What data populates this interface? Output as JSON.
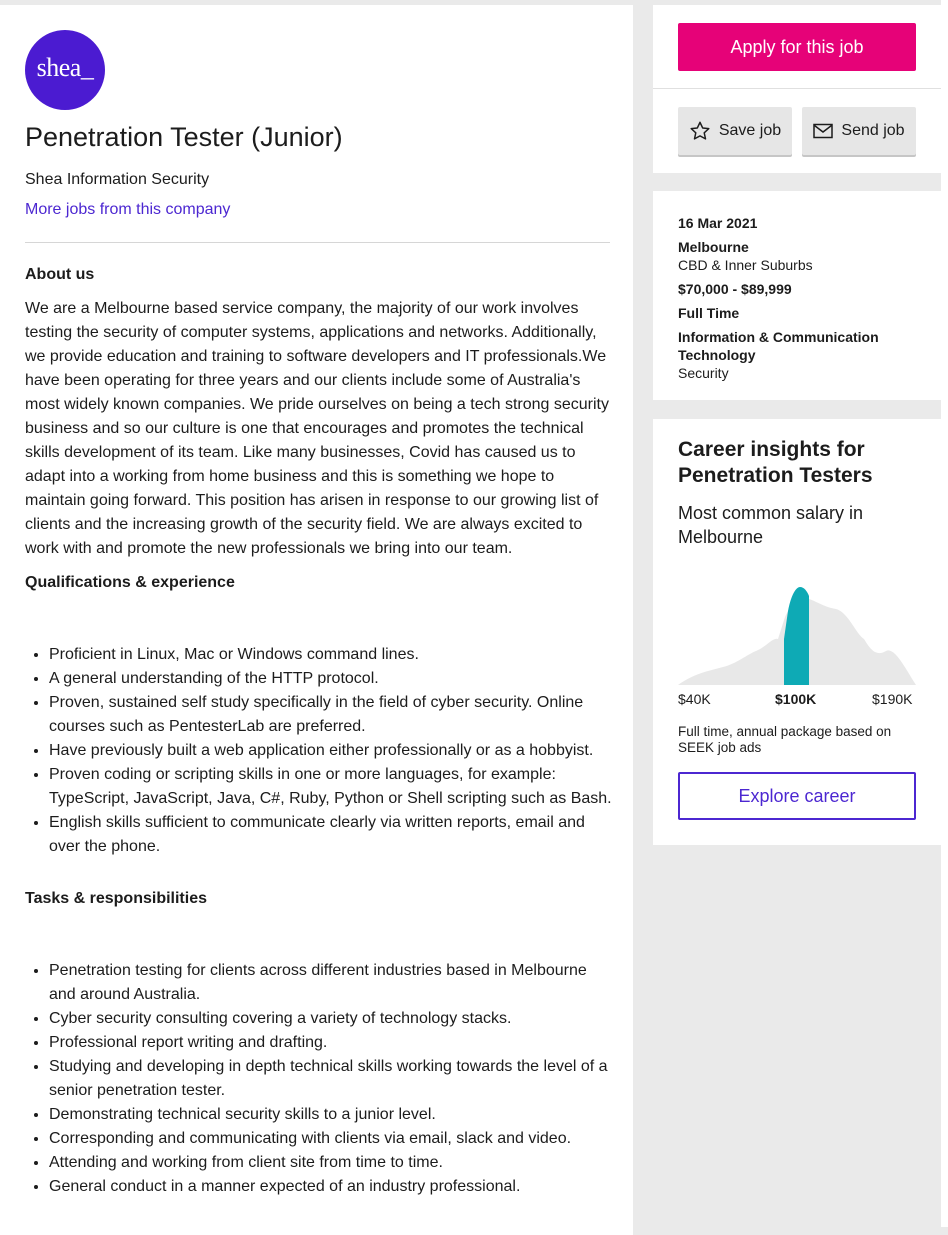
{
  "job": {
    "logo_text": "shea_",
    "title": "Penetration Tester (Junior)",
    "company": "Shea Information Security",
    "more_jobs": "More jobs from this company"
  },
  "about": {
    "heading": "About us",
    "text": "We are a Melbourne based service company, the majority of our work involves testing the security of computer systems, applications and networks. Additionally, we provide education and training to software developers and IT professionals.We have been operating for three years and our clients include some of Australia's most widely known companies. We pride ourselves on being a tech strong security business and so our culture is one that encourages and promotes the technical skills development of its team. Like many businesses, Covid has caused us to adapt into a working from home business and this is something we hope to maintain going forward. This position has arisen in response to our growing list of clients and the increasing growth of the security field. We are always excited to work with and promote the new professionals we bring into our team."
  },
  "qualifications": {
    "heading": "Qualifications & experience",
    "items": [
      "Proficient in Linux, Mac or Windows command lines.",
      "A general understanding of the HTTP protocol.",
      "Proven, sustained self study specifically in the field of cyber security. Online courses such as PentesterLab are preferred.",
      "Have previously built a web application either professionally or as a hobbyist.",
      "Proven coding or scripting skills in one or more languages, for example: TypeScript, JavaScript, Java, C#, Ruby, Python or Shell scripting such as Bash.",
      "English skills sufficient to communicate clearly via written reports, email and over the phone."
    ]
  },
  "tasks": {
    "heading": "Tasks & responsibilities",
    "items": [
      "Penetration testing for clients across different industries based in Melbourne and around Australia.",
      "Cyber security consulting covering a variety of technology stacks.",
      "Professional report writing and drafting.",
      "Studying and developing in depth technical skills working towards the level of a senior penetration tester.",
      "Demonstrating technical security skills to a junior level.",
      "Corresponding and communicating with clients via email, slack and video.",
      "Attending and working from client site from time to time.",
      "General conduct in a manner expected of an industry professional."
    ]
  },
  "actions": {
    "apply": "Apply for this job",
    "save": "Save job",
    "send": "Send job"
  },
  "details": {
    "date": "16 Mar 2021",
    "location": "Melbourne",
    "area": "CBD & Inner Suburbs",
    "salary": "$70,000 - $89,999",
    "work_type": "Full Time",
    "classification_line1": "Information & Communication",
    "classification_line2": "Technology",
    "subclassification": "Security"
  },
  "insights": {
    "title": "Career insights for Penetration Testers",
    "subtitle": "Most common salary in Melbourne",
    "axis_min": "$40K",
    "axis_mid": "$100K",
    "axis_max": "$190K",
    "note": "Full time, annual package based on SEEK job ads",
    "explore": "Explore career"
  },
  "colors": {
    "brand_logo": "#4b1bd1",
    "apply_button": "#e60278",
    "link": "#4c27d1",
    "chart_highlight": "#0eaab5",
    "chart_background": "#e8e8e8"
  },
  "icons": {
    "save": "star-outline-icon",
    "send": "envelope-icon"
  }
}
